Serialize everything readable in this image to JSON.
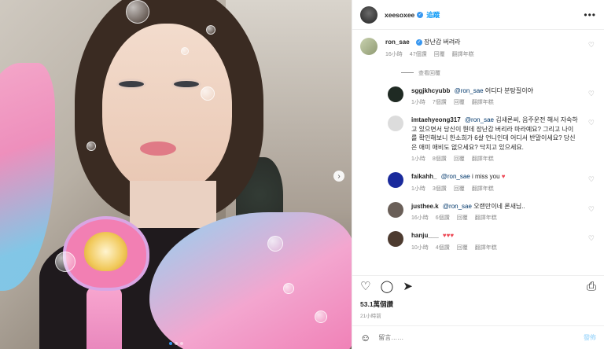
{
  "post": {
    "author": "xeesoxee",
    "follow_label": "追蹤",
    "more_label": "•••"
  },
  "caption_comment": {
    "username": "ron_sae",
    "text": "장난감 버려라",
    "time": "16小時",
    "likes": "47個讚",
    "reply": "回覆",
    "translate": "翻譯年糕"
  },
  "view_replies": "查看回覆",
  "replies": [
    {
      "username": "sggjkhcyubb",
      "mention": "@ron_sae",
      "text": "어디다 분탕질이야",
      "time": "1小時",
      "likes": "7個讚",
      "reply": "回覆",
      "translate": "翻譯年糕",
      "avatar_color": "#1f2a23"
    },
    {
      "username": "imtaehyeong317",
      "mention": "@ron_sae",
      "text": "김새론씨, 음주운전 해서 자숙하고 있으면서 당신이 뭔데 장난감 버리라 마라예요? 그리고 나이를 확인해보니 한소희가 6살 언니인데 어디서 반말이세요? 당신은 애미 애비도 없으세요? 닥치고 있으세요.",
      "time": "1小時",
      "likes": "8個讚",
      "reply": "回覆",
      "translate": "翻譯年糕",
      "avatar_color": "#dcdcdc"
    },
    {
      "username": "faikahh_",
      "mention": "@ron_sae",
      "text": "i miss you",
      "heart": "♥",
      "time": "1小時",
      "likes": "3個讚",
      "reply": "回覆",
      "translate": "翻譯年糕",
      "avatar_color": "#1a2a9c"
    },
    {
      "username": "justhee.k",
      "mention": "@ron_sae",
      "text": "오랜만이네 론새님..",
      "time": "16小時",
      "likes": "6個讚",
      "reply": "回覆",
      "translate": "翻譯年糕",
      "avatar_color": "#6a5f58"
    },
    {
      "username": "hanju___",
      "mention": "",
      "text": "",
      "heart": "♥♥♥",
      "time": "10小時",
      "likes": "4個讚",
      "reply": "回覆",
      "translate": "翻譯年糕",
      "avatar_color": "#4d3b30"
    }
  ],
  "stats": {
    "likes": "53.1萬個讚",
    "time": "21小時前"
  },
  "composer": {
    "placeholder": "留言……",
    "post_label": "發佈"
  },
  "icons": {
    "like": "heart-outline-icon",
    "comment": "comment-icon",
    "share": "paper-plane-icon",
    "save": "bookmark-icon",
    "emoji": "smiley-icon"
  },
  "colors": {
    "accent": "#0095f6",
    "mention": "#00376b",
    "red_heart": "#ed4956"
  }
}
